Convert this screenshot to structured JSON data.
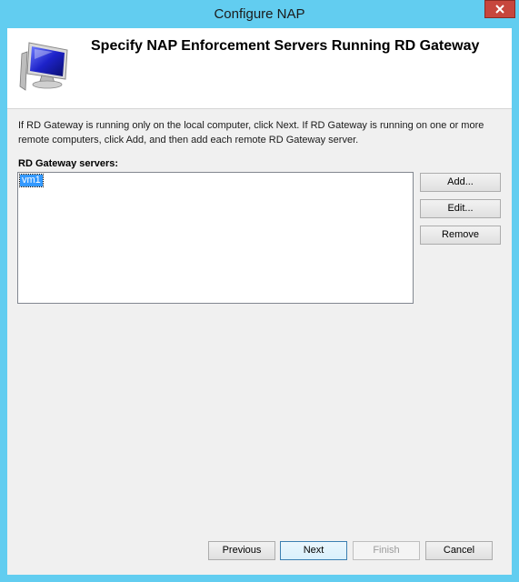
{
  "window": {
    "title": "Configure NAP",
    "close_icon": "close-icon"
  },
  "header": {
    "title": "Specify NAP Enforcement Servers Running RD Gateway",
    "icon": "computer-monitor-icon"
  },
  "description": "If RD Gateway is running only on the local computer, click Next. If RD Gateway is running on one or more remote computers, click Add, and then add each remote RD Gateway server.",
  "servers": {
    "label": "RD Gateway servers:",
    "items": [
      "vm1"
    ],
    "selected": "vm1"
  },
  "side_buttons": {
    "add": "Add...",
    "edit": "Edit...",
    "remove": "Remove"
  },
  "nav_buttons": {
    "previous": "Previous",
    "next": "Next",
    "finish": "Finish",
    "cancel": "Cancel"
  },
  "colors": {
    "titlebar": "#62cdf0",
    "close": "#c7463d",
    "selection": "#3399ff"
  }
}
